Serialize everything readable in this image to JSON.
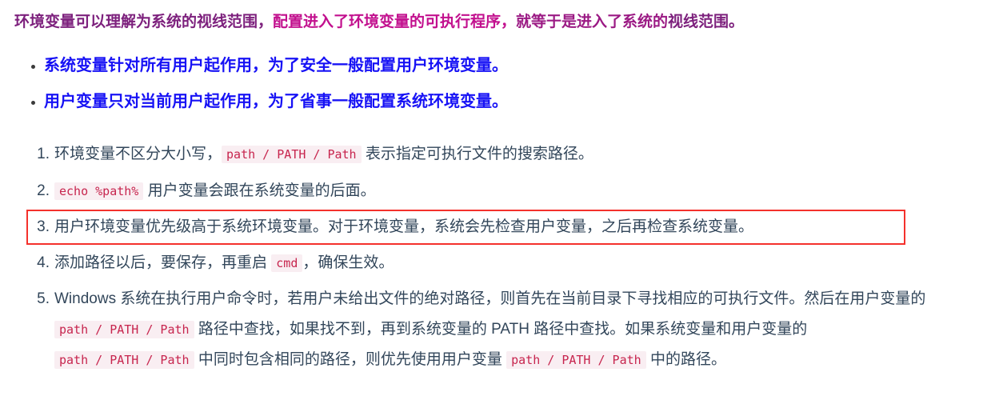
{
  "colors": {
    "heading_purple": "#7d217d",
    "heading_magenta": "#c2108e",
    "bullet_blue": "#1712f5",
    "body_text": "#32465a",
    "code_text": "#c7254e",
    "code_bg": "#f9eef2",
    "highlight_border": "#f4312c"
  },
  "heading": {
    "seg_a": "环境变量可以理解为系统的视线范围，",
    "seg_b": "配置进入了环境变量的可执行程序，",
    "seg_c": "就等于是进入了系统的",
    "seg_d": "视线范围。"
  },
  "bullets": [
    {
      "text": "系统变量针对所有用户起作用，为了安全一般配置用户环境变量。"
    },
    {
      "text": "用户变量只对当前用户起作用，为了省事一般配置系统环境变量。"
    }
  ],
  "numbered": [
    {
      "num": "1.",
      "parts": [
        {
          "type": "text",
          "value": "环境变量不区分大小写，"
        },
        {
          "type": "code",
          "value": "path / PATH / Path"
        },
        {
          "type": "text",
          "value": " 表示指定可执行文件的搜索路径。"
        }
      ]
    },
    {
      "num": "2.",
      "parts": [
        {
          "type": "code",
          "value": "echo %path%"
        },
        {
          "type": "text",
          "value": " 用户变量会跟在系统变量的后面。"
        }
      ]
    },
    {
      "num": "3.",
      "highlighted": true,
      "parts": [
        {
          "type": "text",
          "value": "用户环境变量优先级高于系统环境变量。对于环境变量，系统会先检查用户变量，之后再检查系统变量。"
        }
      ]
    },
    {
      "num": "4.",
      "parts": [
        {
          "type": "text",
          "value": "添加路径以后，要保存，再重启 "
        },
        {
          "type": "code",
          "value": "cmd"
        },
        {
          "type": "text",
          "value": "，确保生效。"
        }
      ]
    },
    {
      "num": "5.",
      "wrap": true,
      "parts": [
        {
          "type": "text",
          "value": "Windows 系统在执行用户命令时，若用户未给出文件的绝对路径，则首先在当前目录下寻找相应的可执行文件。然后在用户变量的 "
        },
        {
          "type": "code",
          "value": "path / PATH / Path"
        },
        {
          "type": "text",
          "value": " 路径中查找，如果找不到，再到系统变量的 PATH 路径中查找。如果系统变量和用户变量的 "
        },
        {
          "type": "code",
          "value": "path / PATH / Path"
        },
        {
          "type": "text",
          "value": " 中同时包含相同的路径，则优先使用用户变量 "
        },
        {
          "type": "code",
          "value": "path / PATH / Path"
        },
        {
          "type": "text",
          "value": " 中的路径。"
        }
      ]
    }
  ]
}
